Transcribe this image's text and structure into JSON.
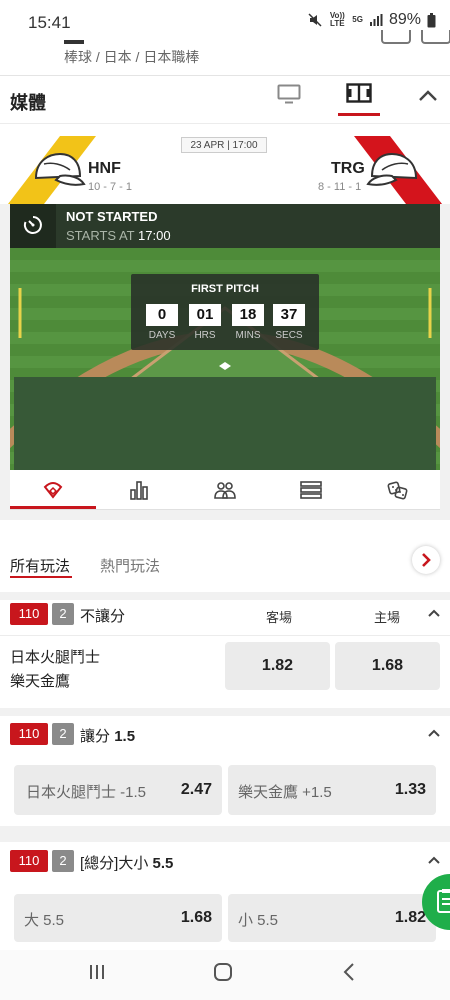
{
  "status_bar": {
    "time": "15:41",
    "network_top": "Vo)) LTE",
    "network_5g": "5G",
    "battery": "89%"
  },
  "breadcrumb": {
    "path": "棒球  /  日本  /  日本職棒"
  },
  "media": {
    "title": "媒體"
  },
  "match": {
    "datetime": "23 APR | 17:00",
    "home": {
      "name": "HNF",
      "record": "10 - 7 - 1",
      "color": "#f2c318"
    },
    "away": {
      "name": "TRG",
      "record": "8 - 11 - 1",
      "color": "#d4141c"
    }
  },
  "stadium": {
    "status": "NOT STARTED",
    "starts_prefix": "STARTS AT",
    "starts_time": "17:00",
    "countdown_title": "FIRST PITCH",
    "countdown": [
      {
        "value": "0",
        "label": "DAYS"
      },
      {
        "value": "01",
        "label": "HRS"
      },
      {
        "value": "18",
        "label": "MINS"
      },
      {
        "value": "37",
        "label": "SECS"
      }
    ]
  },
  "bet_tabs": {
    "all": "所有玩法",
    "hot": "熱門玩法"
  },
  "markets": [
    {
      "code": "110",
      "count": "2",
      "title": "不讓分",
      "col_away": "客場",
      "col_home": "主場",
      "team1": "日本火腿鬥士",
      "team2": "樂天金鷹",
      "odds": [
        "1.82",
        "1.68"
      ]
    },
    {
      "code": "110",
      "count": "2",
      "title_prefix": "讓分",
      "title_value": "1.5",
      "options": [
        {
          "label": "日本火腿鬥士 -1.5",
          "odd": "2.47"
        },
        {
          "label": "樂天金鷹 +1.5",
          "odd": "1.33"
        }
      ]
    },
    {
      "code": "110",
      "count": "2",
      "title_prefix": "[總分]大小",
      "title_value": "5.5",
      "options": [
        {
          "label": "大 5.5",
          "odd": "1.68"
        },
        {
          "label": "小 5.5",
          "odd": "1.82"
        }
      ]
    }
  ],
  "colors": {
    "accent": "#c8161d",
    "field_green": "#4f8a3a",
    "fab_green": "#1fae4a"
  }
}
